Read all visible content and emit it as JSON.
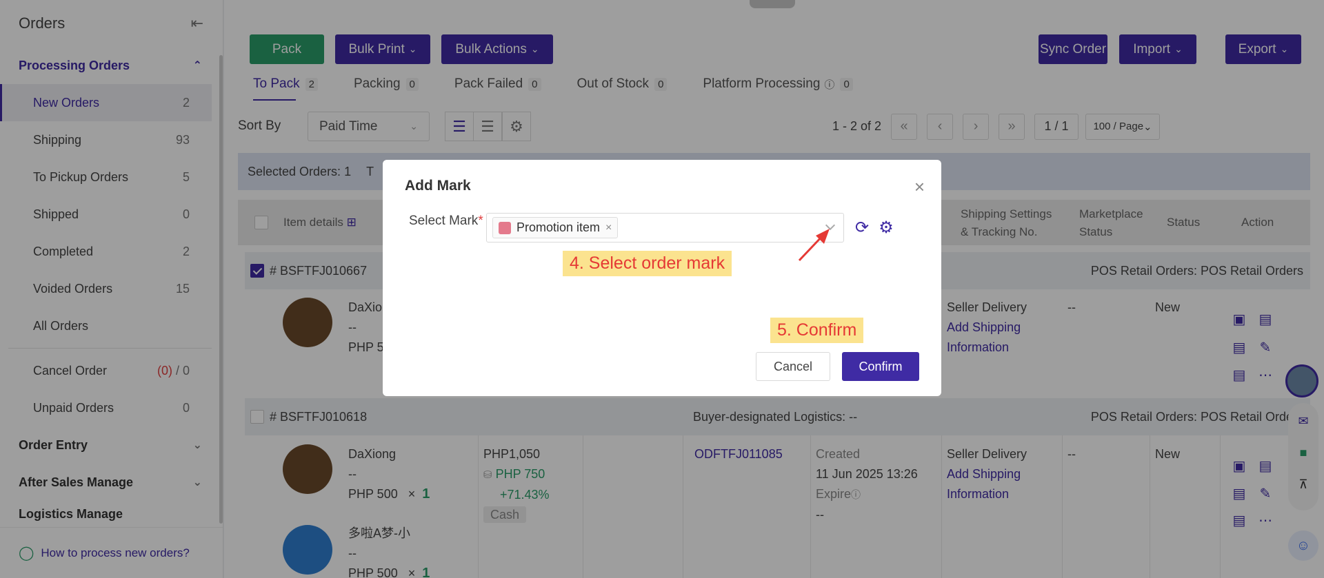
{
  "sidebar": {
    "title": "Orders",
    "groups": {
      "processing": "Processing Orders",
      "order_entry": "Order Entry",
      "after_sales": "After Sales Manage",
      "logistics": "Logistics Manage"
    },
    "items": [
      {
        "label": "New Orders",
        "count": "2"
      },
      {
        "label": "Shipping",
        "count": "93"
      },
      {
        "label": "To Pickup Orders",
        "count": "5"
      },
      {
        "label": "Shipped",
        "count": "0"
      },
      {
        "label": "Completed",
        "count": "2"
      },
      {
        "label": "Voided Orders",
        "count": "15"
      },
      {
        "label": "All Orders",
        "count": ""
      }
    ],
    "cancel_order": {
      "label": "Cancel Order",
      "count_a": "(0)",
      "sep": " / ",
      "count_b": "0"
    },
    "unpaid_orders": {
      "label": "Unpaid Orders",
      "count": "0"
    },
    "help_link": "How to process new orders?"
  },
  "toolbar": {
    "pack": "Pack",
    "bulk_print": "Bulk Print",
    "bulk_actions": "Bulk Actions",
    "sync_order": "Sync Order",
    "import": "Import",
    "export": "Export"
  },
  "tabs": [
    {
      "label": "To Pack",
      "count": "2"
    },
    {
      "label": "Packing",
      "count": "0"
    },
    {
      "label": "Pack Failed",
      "count": "0"
    },
    {
      "label": "Out of Stock",
      "count": "0"
    },
    {
      "label": "Platform Processing",
      "count": "0"
    }
  ],
  "sort": {
    "label": "Sort By",
    "value": "Paid Time"
  },
  "pagination": {
    "range": "1 - 2 of 2",
    "page": "1 / 1",
    "page_size": "100 / Page"
  },
  "selection": {
    "text": "Selected Orders: 1",
    "trailing": "T"
  },
  "table_headers": {
    "item_details": "Item details",
    "shipping": "Shipping Settings & Tracking No.",
    "marketplace": "Marketplace Status",
    "status": "Status",
    "action": "Action"
  },
  "orders": [
    {
      "id": "# BSFTFJ010667",
      "store": "POS Retail Orders: POS Retail Orders",
      "item_name": "DaXio",
      "item_sub": "--",
      "item_price": "PHP 5",
      "shipping_line1": "Seller Delivery",
      "shipping_link": "Add Shipping Information",
      "marketplace": "--",
      "status": "New"
    },
    {
      "id": "# BSFTFJ010618",
      "logistics": "Buyer-designated Logistics: --",
      "store": "POS Retail Orders: POS Retail Orders",
      "item_name": "DaXiong",
      "item_sub": "--",
      "item_price": "PHP 500",
      "item_qty_x": "×",
      "item_qty": "1",
      "item2_name": "多啦A梦-小",
      "item2_sub": "--",
      "item2_price": "PHP 500",
      "item2_qty": "1",
      "amount": "PHP1,050",
      "cost": "PHP 750",
      "margin": "+71.43%",
      "payment": "Cash",
      "package_no": "ODFTFJ011085",
      "created_label": "Created",
      "created_time": "11 Jun 2025 13:26",
      "expire_label": "Expire",
      "expire_value": "--",
      "shipping_line1": "Seller Delivery",
      "shipping_link": "Add Shipping Information",
      "marketplace": "--",
      "status": "New"
    }
  ],
  "modal": {
    "title": "Add Mark",
    "field_label": "Select Mark",
    "required": "*",
    "selected_tag": "Promotion item",
    "tag_color": "#e47a8c",
    "cancel": "Cancel",
    "confirm": "Confirm"
  },
  "annotations": {
    "step4": "4. Select order mark",
    "step5": "5. Confirm"
  },
  "colors": {
    "primary": "#3f2ba4",
    "success": "#2a9d69",
    "annotation_bg": "#fbe38f",
    "annotation_text": "#e53935"
  }
}
